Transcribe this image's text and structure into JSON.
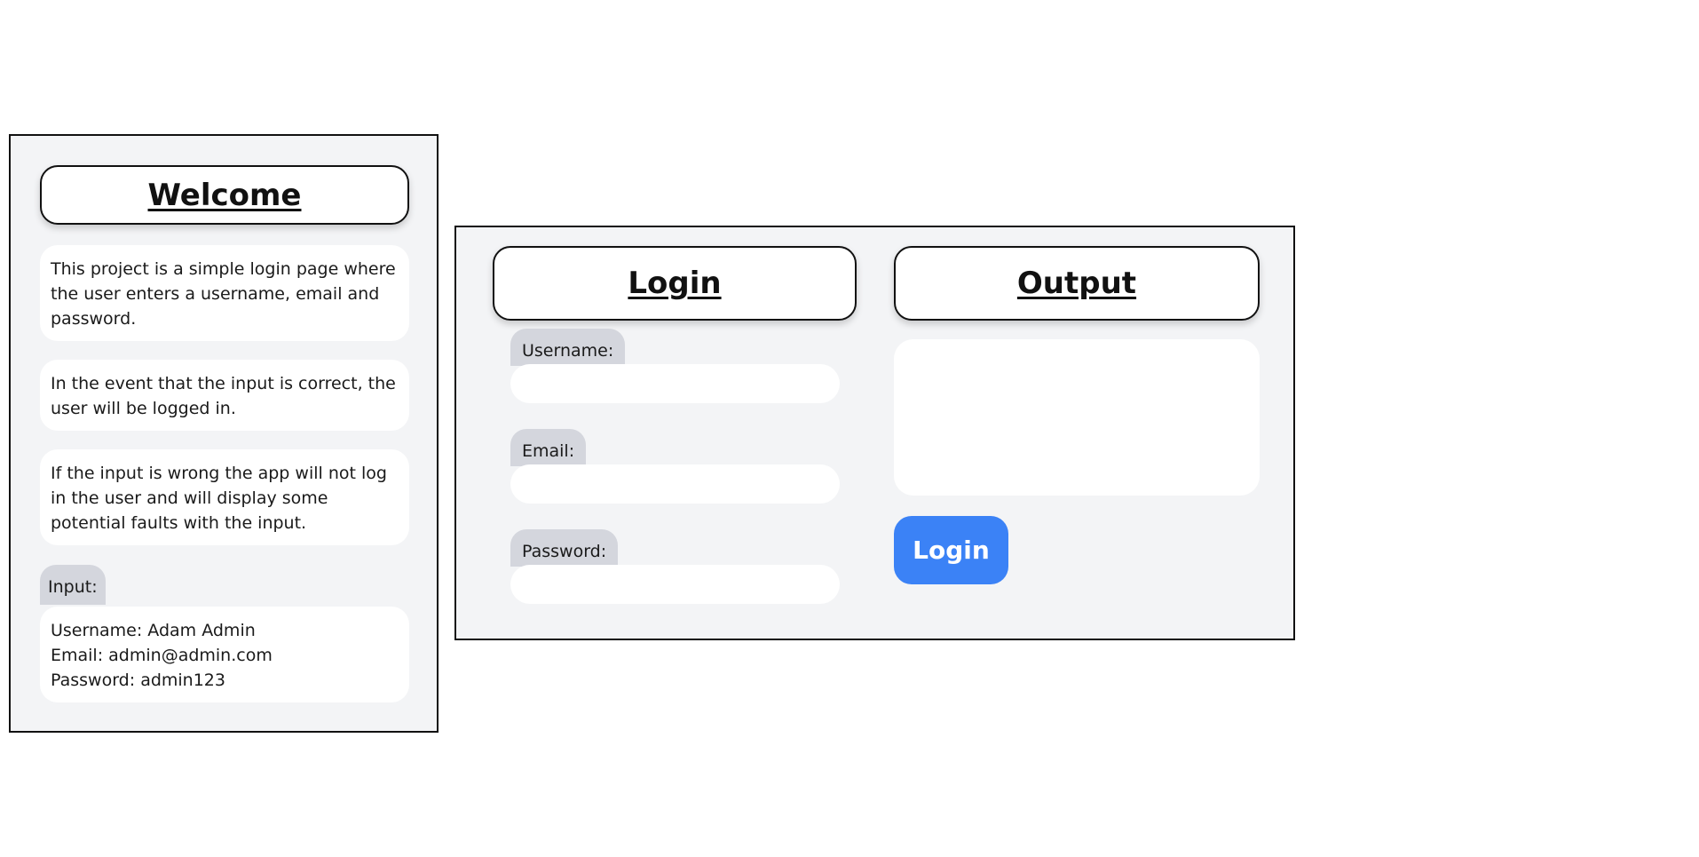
{
  "welcome": {
    "title": "Welcome",
    "paragraphs": [
      "This project is a simple login page where the user enters a username, email and password.",
      "In the event that the input is correct, the user will be logged in.",
      "If the input is wrong the app will not log in the user and will display some potential faults with the input."
    ],
    "input_tag": "Input:",
    "credentials": {
      "username": "Username: Adam Admin",
      "email": "Email: admin@admin.com",
      "password": "Password: admin123"
    }
  },
  "login": {
    "title": "Login",
    "username_label": "Username:",
    "username_value": "",
    "email_label": "Email:",
    "email_value": "",
    "password_label": "Password:",
    "password_value": ""
  },
  "output": {
    "title": "Output",
    "content": ""
  },
  "actions": {
    "login_button": "Login"
  },
  "colors": {
    "panel_bg": "#f3f4f6",
    "tag_bg": "#d4d6dd",
    "primary_button": "#3b82f6"
  }
}
